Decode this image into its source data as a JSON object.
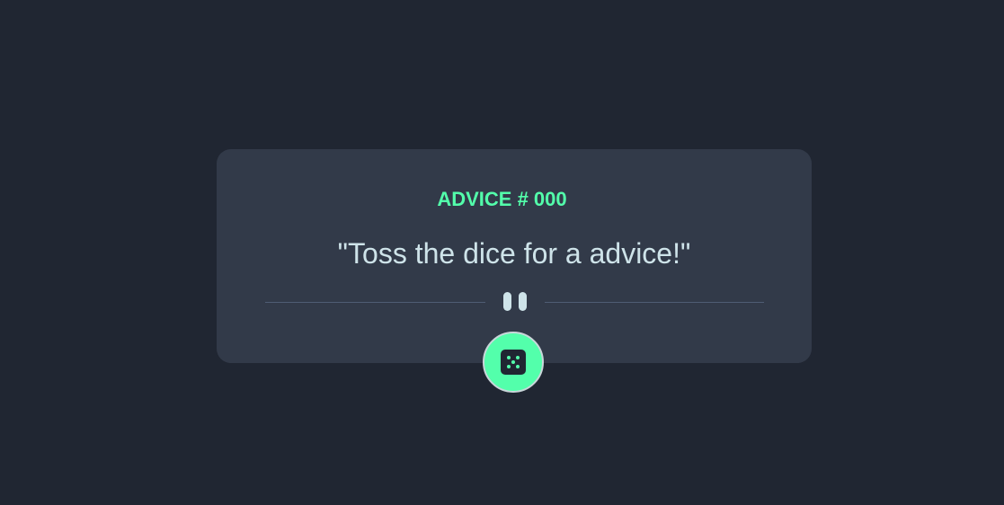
{
  "advice": {
    "id_label": "ADVICE # 000",
    "text": "\"Toss the dice for a advice!\""
  },
  "icons": {
    "divider": "pause-icon",
    "button": "dice-icon"
  },
  "colors": {
    "background": "#202632",
    "card": "#323a49",
    "accent": "#53ffab",
    "text": "#cee3e9",
    "divider": "#4f5d74"
  }
}
